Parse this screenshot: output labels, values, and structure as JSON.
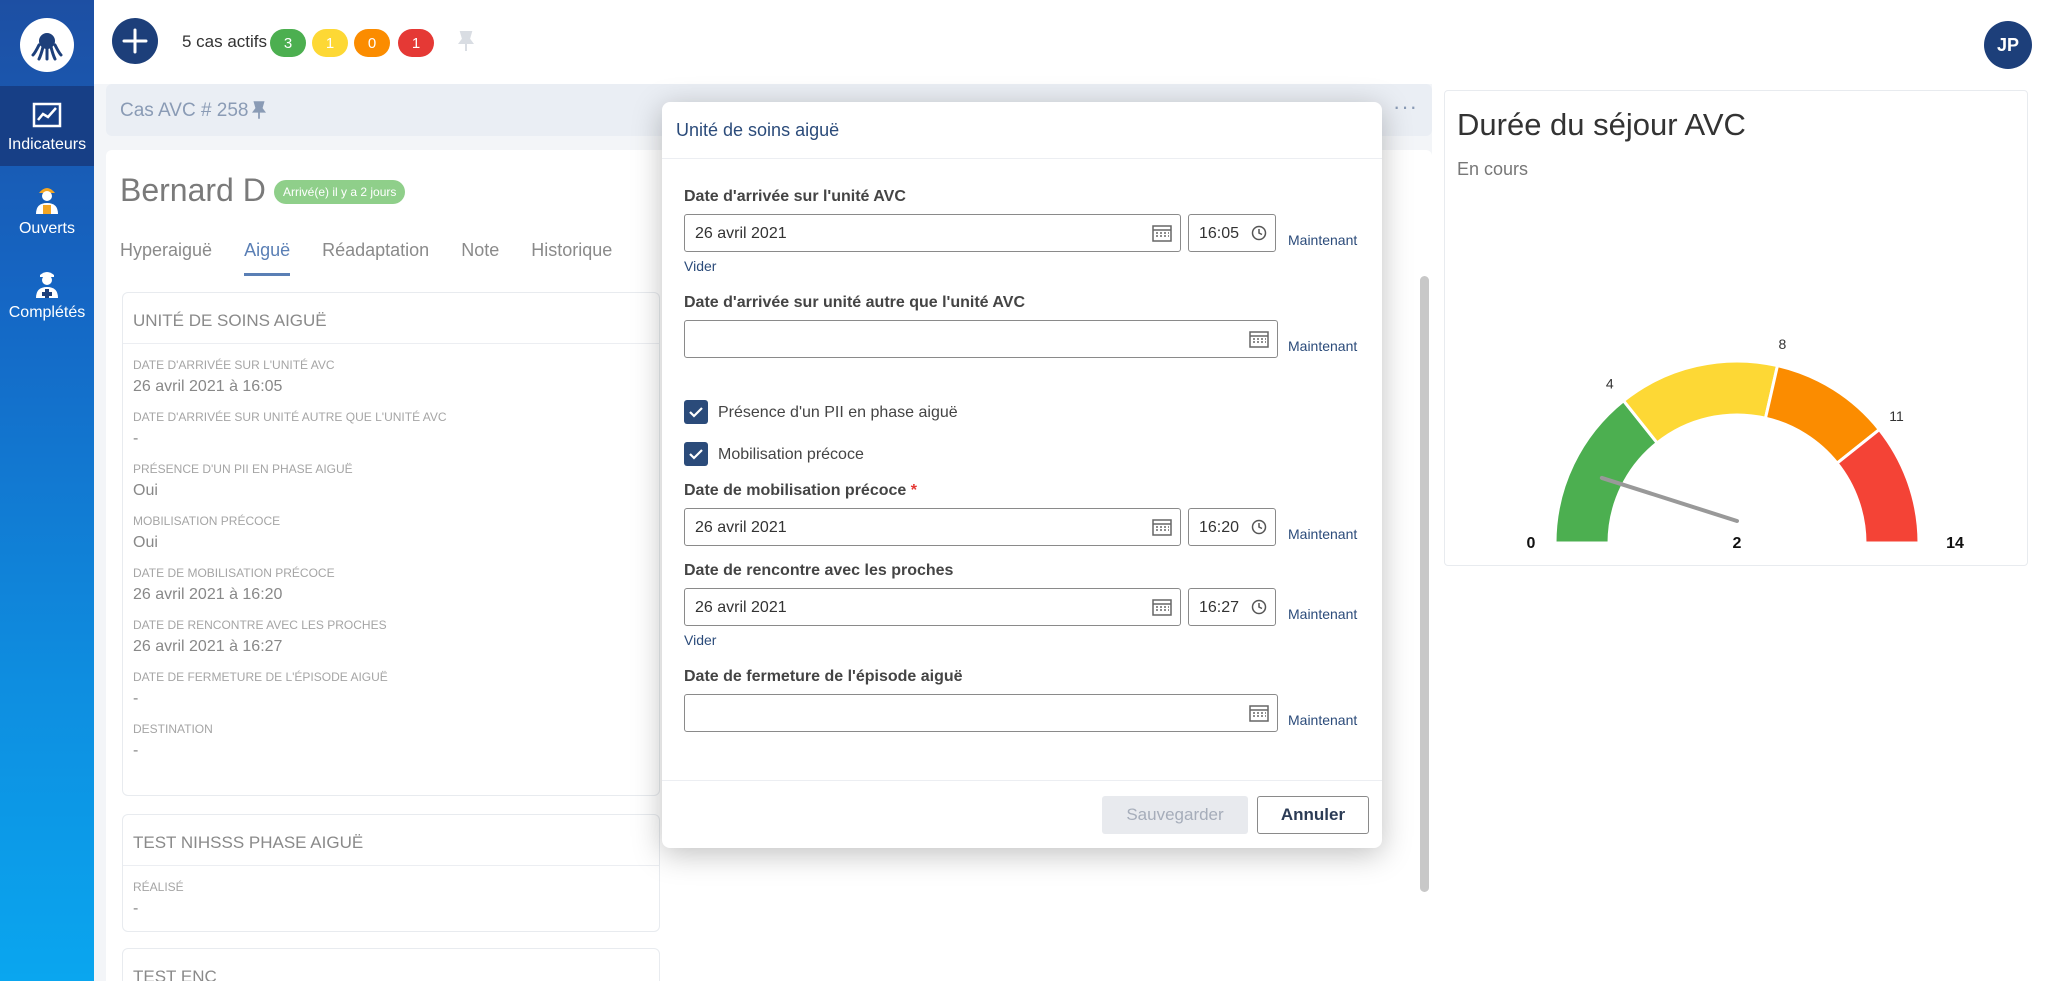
{
  "sidebar": {
    "items": [
      {
        "label": "Indicateurs",
        "icon": "chart-icon",
        "active": true
      },
      {
        "label": "Ouverts",
        "icon": "worker-icon",
        "active": false
      },
      {
        "label": "Complétés",
        "icon": "nurse-icon",
        "active": false
      }
    ]
  },
  "topbar": {
    "cases_label": "5 cas actifs",
    "counts": [
      {
        "value": "3",
        "color": "#4caf50"
      },
      {
        "value": "1",
        "color": "#fdd835"
      },
      {
        "value": "0",
        "color": "#fb8c00"
      },
      {
        "value": "1",
        "color": "#e53935"
      }
    ],
    "user_initials": "JP"
  },
  "case": {
    "title": "Cas AVC # 258",
    "patient_name": "Bernard D",
    "arrival_badge": "Arrivé(e) il y a 2 jours",
    "tabs": [
      "Hyperaiguë",
      "Aiguë",
      "Réadaptation",
      "Note",
      "Historique"
    ],
    "active_tab": "Aiguë"
  },
  "sections": {
    "acute_unit": {
      "title": "UNITÉ DE SOINS AIGUË",
      "fields": [
        {
          "label": "DATE D'ARRIVÉE SUR L'UNITÉ AVC",
          "value": "26 avril 2021 à 16:05"
        },
        {
          "label": "DATE D'ARRIVÉE SUR UNITÉ AUTRE QUE L'UNITÉ AVC",
          "value": "-"
        },
        {
          "label": "PRÉSENCE D'UN PII EN PHASE AIGUË",
          "value": "Oui"
        },
        {
          "label": "MOBILISATION PRÉCOCE",
          "value": "Oui"
        },
        {
          "label": "DATE DE MOBILISATION PRÉCOCE",
          "value": "26 avril 2021 à 16:20"
        },
        {
          "label": "DATE DE RENCONTRE AVEC LES PROCHES",
          "value": "26 avril 2021 à 16:27"
        },
        {
          "label": "DATE DE FERMETURE DE L'ÉPISODE AIGUË",
          "value": "-"
        },
        {
          "label": "DESTINATION",
          "value": "-"
        }
      ]
    },
    "nihss": {
      "title": "TEST NIHSSS PHASE AIGUË",
      "fields": [
        {
          "label": "RÉALISÉ",
          "value": "-"
        }
      ]
    },
    "enc": {
      "title": "TEST ENC"
    }
  },
  "modal": {
    "title": "Unité de soins aiguë",
    "arrival_avc": {
      "label": "Date d'arrivée sur l'unité AVC",
      "date": "26 avril 2021",
      "time": "16:05"
    },
    "arrival_other": {
      "label": "Date d'arrivée sur unité autre que l'unité AVC",
      "date": ""
    },
    "pii": {
      "label": "Présence d'un PII en phase aiguë",
      "checked": true
    },
    "mobilisation": {
      "label": "Mobilisation précoce",
      "checked": true
    },
    "mobilisation_date": {
      "label": "Date de mobilisation précoce",
      "required_mark": "*",
      "date": "26 avril 2021",
      "time": "16:20"
    },
    "meeting": {
      "label": "Date de rencontre avec les proches",
      "date": "26 avril 2021",
      "time": "16:27"
    },
    "closing": {
      "label": "Date de fermeture de l'épisode aiguë",
      "date": ""
    },
    "now_label": "Maintenant",
    "clear_label": "Vider",
    "save_label": "Sauvegarder",
    "cancel_label": "Annuler"
  },
  "gauge": {
    "title": "Durée du séjour AVC",
    "subtitle": "En cours",
    "min_label": "0",
    "max_label": "14",
    "value_label": "2",
    "value": 2,
    "max": 14,
    "thresholds": [
      4,
      8,
      11
    ],
    "threshold_labels": [
      "4",
      "8",
      "11"
    ],
    "band_colors": [
      "#4caf50",
      "#fdd835",
      "#fb8c00",
      "#f44336"
    ]
  }
}
